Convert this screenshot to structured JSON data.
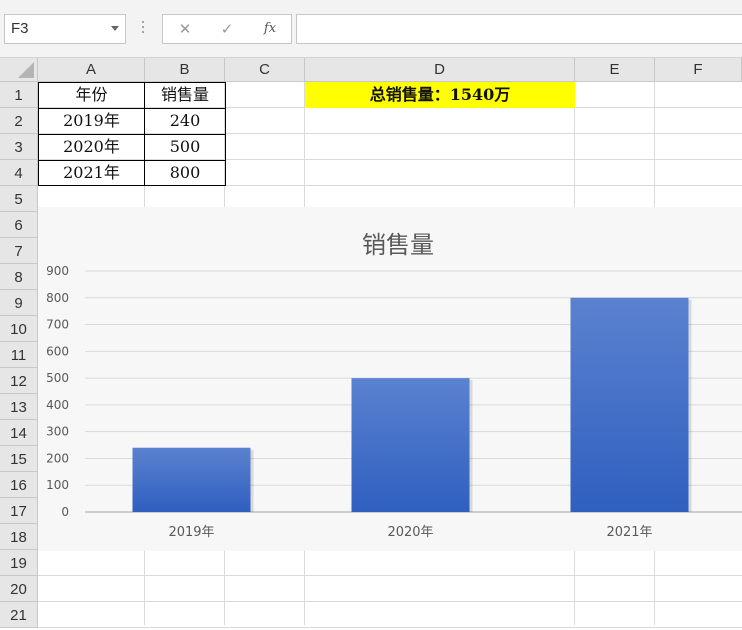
{
  "formula_bar": {
    "name_box": "F3",
    "cancel_icon": "✕",
    "enter_icon": "✓",
    "fx_label": "fx",
    "formula_value": ""
  },
  "sheet": {
    "columns": [
      "A",
      "B",
      "C",
      "D",
      "E",
      "F"
    ],
    "rows": [
      "1",
      "2",
      "3",
      "4",
      "5",
      "6",
      "7",
      "8",
      "9",
      "10",
      "11",
      "12",
      "13",
      "14",
      "15",
      "16",
      "17",
      "18",
      "19",
      "20",
      "21"
    ],
    "table": {
      "header": [
        "年份",
        "销售量"
      ],
      "rows": [
        [
          "2019年",
          "240"
        ],
        [
          "2020年",
          "500"
        ],
        [
          "2021年",
          "800"
        ]
      ]
    },
    "total_label": "总销售量：1540万",
    "highlight_color": "#ffff00"
  },
  "chart_data": {
    "type": "bar",
    "title": "销售量",
    "categories": [
      "2019年",
      "2020年",
      "2021年"
    ],
    "values": [
      240,
      500,
      800
    ],
    "ylim": [
      0,
      900
    ],
    "yticks": [
      0,
      100,
      200,
      300,
      400,
      500,
      600,
      700,
      800,
      900
    ],
    "grid": true,
    "legend": "none",
    "bar_color_top": "#5b82d0",
    "bar_color_bottom": "#2f5fbf"
  }
}
